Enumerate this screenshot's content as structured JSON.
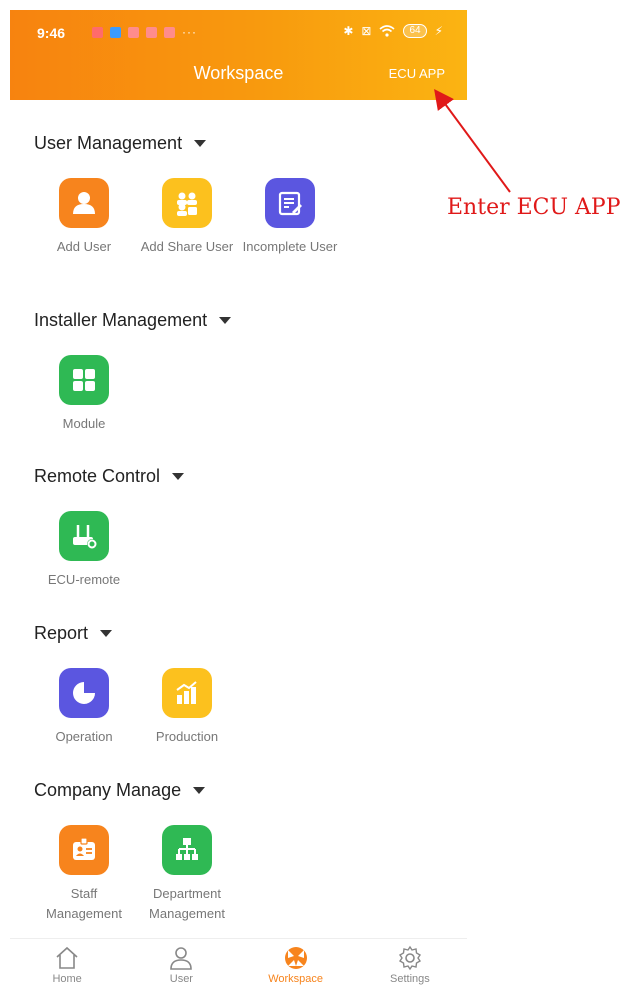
{
  "status_bar": {
    "time": "9:46",
    "dots": "···",
    "battery": "64"
  },
  "header": {
    "title": "Workspace",
    "action_label": "ECU APP"
  },
  "sections": [
    {
      "title": "User Management",
      "items": [
        {
          "label": "Add User",
          "icon": "person-icon",
          "color": "#f7841d"
        },
        {
          "label": "Add Share User",
          "icon": "share-users-icon",
          "color": "#fcc11e"
        },
        {
          "label": "Incomplete User",
          "icon": "edit-document-icon",
          "color": "#5b56e0"
        }
      ]
    },
    {
      "title": "Installer Management",
      "items": [
        {
          "label": "Module",
          "icon": "grid-icon",
          "color": "#2fb954"
        }
      ]
    },
    {
      "title": "Remote Control",
      "items": [
        {
          "label": "ECU-remote",
          "icon": "router-gear-icon",
          "color": "#2fb954"
        }
      ]
    },
    {
      "title": "Report",
      "items": [
        {
          "label": "Operation",
          "icon": "pie-chart-icon",
          "color": "#5b56e0"
        },
        {
          "label": "Production",
          "icon": "bar-chart-icon",
          "color": "#fcc11e"
        }
      ]
    },
    {
      "title": "Company Manage",
      "items": [
        {
          "label": "Staff Management",
          "icon": "id-card-icon",
          "color": "#f7841d"
        },
        {
          "label": "Department Management",
          "icon": "org-chart-icon",
          "color": "#2fb954"
        }
      ]
    }
  ],
  "bottom_nav": [
    {
      "label": "Home",
      "icon": "home-icon"
    },
    {
      "label": "User",
      "icon": "user-icon"
    },
    {
      "label": "Workspace",
      "icon": "workspace-icon",
      "active": true
    },
    {
      "label": "Settings",
      "icon": "gear-icon"
    }
  ],
  "annotation": {
    "text": "Enter ECU APP",
    "color": "#e01919"
  }
}
